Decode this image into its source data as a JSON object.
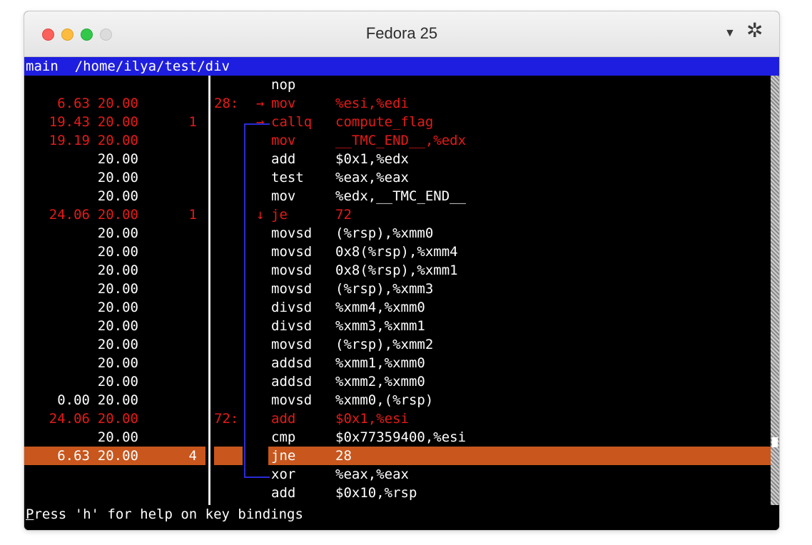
{
  "window": {
    "title": "Fedora 25",
    "menu_icon": "dropdown-triangle-icon",
    "settings_icon": "gear-icon"
  },
  "terminal": {
    "header": "main  /home/ilya/test/div",
    "status_first_letter": "P",
    "status_rest": "ress 'h' for help on key bindings",
    "colors": {
      "hot": "#e51a1a",
      "highlight": "#c8561d",
      "header_bg": "#1e1ee0",
      "jump": "#2a2ad8"
    },
    "rows": [
      {
        "pct": "",
        "per": "",
        "cnt": "",
        "addr": "",
        "arrow": "",
        "mn": "nop",
        "op": "",
        "style": "white"
      },
      {
        "pct": "6.63",
        "per": "20.00",
        "cnt": "",
        "addr": "28:",
        "arrow": "→",
        "mn": "mov",
        "op": "%esi,%edi",
        "style": "red"
      },
      {
        "pct": "19.43",
        "per": "20.00",
        "cnt": "1",
        "addr": "",
        "arrow": "→",
        "mn": "callq",
        "op": "compute_flag",
        "style": "red"
      },
      {
        "pct": "19.19",
        "per": "20.00",
        "cnt": "",
        "addr": "",
        "arrow": "",
        "mn": "mov",
        "op": "__TMC_END__,%edx",
        "style": "red"
      },
      {
        "pct": "",
        "per": "20.00",
        "cnt": "",
        "addr": "",
        "arrow": "",
        "mn": "add",
        "op": "$0x1,%edx",
        "style": "white"
      },
      {
        "pct": "",
        "per": "20.00",
        "cnt": "",
        "addr": "",
        "arrow": "",
        "mn": "test",
        "op": "%eax,%eax",
        "style": "white"
      },
      {
        "pct": "",
        "per": "20.00",
        "cnt": "",
        "addr": "",
        "arrow": "",
        "mn": "mov",
        "op": "%edx,__TMC_END__",
        "style": "white"
      },
      {
        "pct": "24.06",
        "per": "20.00",
        "cnt": "1",
        "addr": "",
        "arrow": "↓",
        "mn": "je",
        "op": "72",
        "style": "red"
      },
      {
        "pct": "",
        "per": "20.00",
        "cnt": "",
        "addr": "",
        "arrow": "",
        "mn": "movsd",
        "op": "(%rsp),%xmm0",
        "style": "white"
      },
      {
        "pct": "",
        "per": "20.00",
        "cnt": "",
        "addr": "",
        "arrow": "",
        "mn": "movsd",
        "op": "0x8(%rsp),%xmm4",
        "style": "white"
      },
      {
        "pct": "",
        "per": "20.00",
        "cnt": "",
        "addr": "",
        "arrow": "",
        "mn": "movsd",
        "op": "0x8(%rsp),%xmm1",
        "style": "white"
      },
      {
        "pct": "",
        "per": "20.00",
        "cnt": "",
        "addr": "",
        "arrow": "",
        "mn": "movsd",
        "op": "(%rsp),%xmm3",
        "style": "white"
      },
      {
        "pct": "",
        "per": "20.00",
        "cnt": "",
        "addr": "",
        "arrow": "",
        "mn": "divsd",
        "op": "%xmm4,%xmm0",
        "style": "white"
      },
      {
        "pct": "",
        "per": "20.00",
        "cnt": "",
        "addr": "",
        "arrow": "",
        "mn": "divsd",
        "op": "%xmm3,%xmm1",
        "style": "white"
      },
      {
        "pct": "",
        "per": "20.00",
        "cnt": "",
        "addr": "",
        "arrow": "",
        "mn": "movsd",
        "op": "(%rsp),%xmm2",
        "style": "white"
      },
      {
        "pct": "",
        "per": "20.00",
        "cnt": "",
        "addr": "",
        "arrow": "",
        "mn": "addsd",
        "op": "%xmm1,%xmm0",
        "style": "white"
      },
      {
        "pct": "",
        "per": "20.00",
        "cnt": "",
        "addr": "",
        "arrow": "",
        "mn": "addsd",
        "op": "%xmm2,%xmm0",
        "style": "white"
      },
      {
        "pct": "0.00",
        "per": "20.00",
        "cnt": "",
        "addr": "",
        "arrow": "",
        "mn": "movsd",
        "op": "%xmm0,(%rsp)",
        "style": "white"
      },
      {
        "pct": "24.06",
        "per": "20.00",
        "cnt": "",
        "addr": "72:",
        "arrow": "",
        "mn": "add",
        "op": "$0x1,%esi",
        "style": "red"
      },
      {
        "pct": "",
        "per": "20.00",
        "cnt": "",
        "addr": "",
        "arrow": "",
        "mn": "cmp",
        "op": "$0x77359400,%esi",
        "style": "white"
      },
      {
        "pct": "6.63",
        "per": "20.00",
        "cnt": "4",
        "addr": "",
        "arrow": "",
        "mn": "jne",
        "op": "28",
        "style": "highlight"
      },
      {
        "pct": "",
        "per": "",
        "cnt": "",
        "addr": "",
        "arrow": "",
        "mn": "xor",
        "op": "%eax,%eax",
        "style": "white"
      },
      {
        "pct": "",
        "per": "",
        "cnt": "",
        "addr": "",
        "arrow": "",
        "mn": "add",
        "op": "$0x10,%rsp",
        "style": "white"
      }
    ]
  }
}
